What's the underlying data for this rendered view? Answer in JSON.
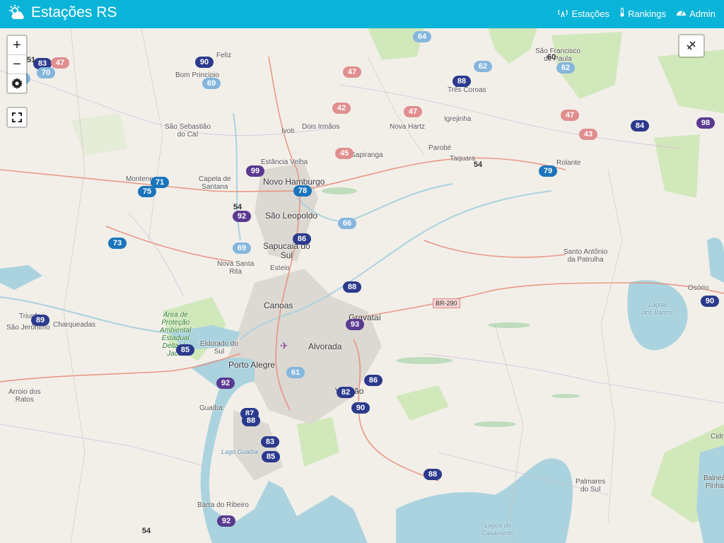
{
  "app": {
    "title": "Estações RS"
  },
  "nav": {
    "stations": "Estações",
    "rankings": "Rankings",
    "admin": "Admin"
  },
  "controls": {
    "zoom_in": "+",
    "zoom_out": "−",
    "settings_icon": "gear-icon",
    "fullscreen_icon": "fullscreen-icon",
    "layers_icon": "layers-icon"
  },
  "road_label": "BR-290",
  "places": {
    "novo_hamburgo": "Novo Hamburgo",
    "sao_leopoldo": "São Leopoldo",
    "sapucaia": "Sapucaia do\nSul",
    "canoas": "Canoas",
    "gravatai": "Gravataí",
    "alvorada": "Alvorada",
    "porto_alegre": "Porto Alegre",
    "viamao": "Viamão",
    "esteio": "Esteio",
    "feliz": "Feliz",
    "bom_principio": "Bom Princípio",
    "sao_sebastiao": "São Sebastião\ndo Caí",
    "ivoti": "Ivoti",
    "dois_irmaos": "Dois Irmãos",
    "nova_hartz": "Nova Hartz",
    "igrejinha": "Igrejinha",
    "tres_coroas": "Três Coroas",
    "parobe": "Parobé",
    "taquara": "Taquara",
    "rolante": "Rolante",
    "estancia_velha": "Estância Velha",
    "sapiranga": "Sapiranga",
    "capela": "Capela de\nSantana",
    "montenegro": "Montenegro",
    "nova_santa_rita": "Nova Santa\nRita",
    "santo_antonio": "Santo Antônio\nda Patrulha",
    "osorio": "Osório",
    "lagoa_barros": "Lagoa\ndos Barros",
    "triunfo": "Triunfo",
    "sao_jeronimo": "São Jerônimo",
    "charqueadas": "Charqueadas",
    "eldorado": "Eldorado do\nSul",
    "area_protecao": "Área de\nProteção\nAmbiental\nEstadual\nDelta do\nJacuí",
    "guaiba": "Guaíba",
    "lago_guaiba": "Lago Guaíba",
    "arroio_ratos": "Arroio dos\nRatos",
    "barra_ribeiro": "Barra do Ribeiro",
    "palmares": "Palmares\ndo Sul",
    "lagoa_casamento": "Lagoa do\nCasamento",
    "sao_francisco": "São Francisco\nde Paula",
    "balneario_pinhal": "Balneá\nPinha",
    "cidreira": "Cidr"
  },
  "colors": {
    "navbar": "#0ab4d8",
    "level_dark_blue": "#2b3a8c",
    "level_blue": "#1b75bc",
    "level_light_blue": "#85b6dd",
    "level_purple": "#5a3a91",
    "level_pink": "#e08e8e",
    "level_grey": "#d9d9d9",
    "water": "#aad3df",
    "vegetation": "#c8e6b0"
  },
  "markers": [
    {
      "v": "90",
      "c": "#2b3a8c"
    },
    {
      "v": "69",
      "c": "#85b6dd"
    },
    {
      "v": "47",
      "c": "#e08e8e"
    },
    {
      "v": "64",
      "c": "#85b6dd"
    },
    {
      "v": "62",
      "c": "#85b6dd"
    },
    {
      "v": "60",
      "c": "#e6e6e6"
    },
    {
      "v": "62",
      "c": "#85b6dd"
    },
    {
      "v": "88",
      "c": "#2b3a8c"
    },
    {
      "v": "42",
      "c": "#e08e8e"
    },
    {
      "v": "47",
      "c": "#e08e8e"
    },
    {
      "v": "47",
      "c": "#e08e8e"
    },
    {
      "v": "43",
      "c": "#e08e8e"
    },
    {
      "v": "84",
      "c": "#2b3a8c"
    },
    {
      "v": "98",
      "c": "#5a3a91"
    },
    {
      "v": "45",
      "c": "#e08e8e"
    },
    {
      "v": "54",
      "c": "#e6e6e6"
    },
    {
      "v": "99",
      "c": "#5a3a91"
    },
    {
      "v": "79",
      "c": "#1b75bc"
    },
    {
      "v": "71",
      "c": "#1b75bc"
    },
    {
      "v": "75",
      "c": "#1b75bc"
    },
    {
      "v": "78",
      "c": "#1b75bc"
    },
    {
      "v": "54",
      "c": "#e6e6e6"
    },
    {
      "v": "92",
      "c": "#5a3a91"
    },
    {
      "v": "66",
      "c": "#85b6dd"
    },
    {
      "v": "73",
      "c": "#1b75bc"
    },
    {
      "v": "86",
      "c": "#2b3a8c"
    },
    {
      "v": "69",
      "c": "#85b6dd"
    },
    {
      "v": "88",
      "c": "#2b3a8c"
    },
    {
      "v": "89",
      "c": "#2b3a8c"
    },
    {
      "v": "93",
      "c": "#5a3a91"
    },
    {
      "v": "90",
      "c": "#2b3a8c"
    },
    {
      "v": "85",
      "c": "#2b3a8c"
    },
    {
      "v": "61",
      "c": "#85b6dd"
    },
    {
      "v": "86",
      "c": "#2b3a8c"
    },
    {
      "v": "92",
      "c": "#5a3a91"
    },
    {
      "v": "82",
      "c": "#2b3a8c"
    },
    {
      "v": "90",
      "c": "#2b3a8c"
    },
    {
      "v": "87",
      "c": "#2b3a8c"
    },
    {
      "v": "88",
      "c": "#2b3a8c"
    },
    {
      "v": "83",
      "c": "#2b3a8c"
    },
    {
      "v": "85",
      "c": "#2b3a8c"
    },
    {
      "v": "88",
      "c": "#2b3a8c"
    },
    {
      "v": "92",
      "c": "#5a3a91"
    },
    {
      "v": "54",
      "c": "#e6e6e6"
    },
    {
      "v": "83",
      "c": "#2b3a8c"
    },
    {
      "v": "47",
      "c": "#e08e8e"
    },
    {
      "v": "70",
      "c": "#85b6dd"
    },
    {
      "v": "62",
      "c": "#85b6dd"
    },
    {
      "v": "51",
      "c": "#e6e6e6"
    }
  ]
}
